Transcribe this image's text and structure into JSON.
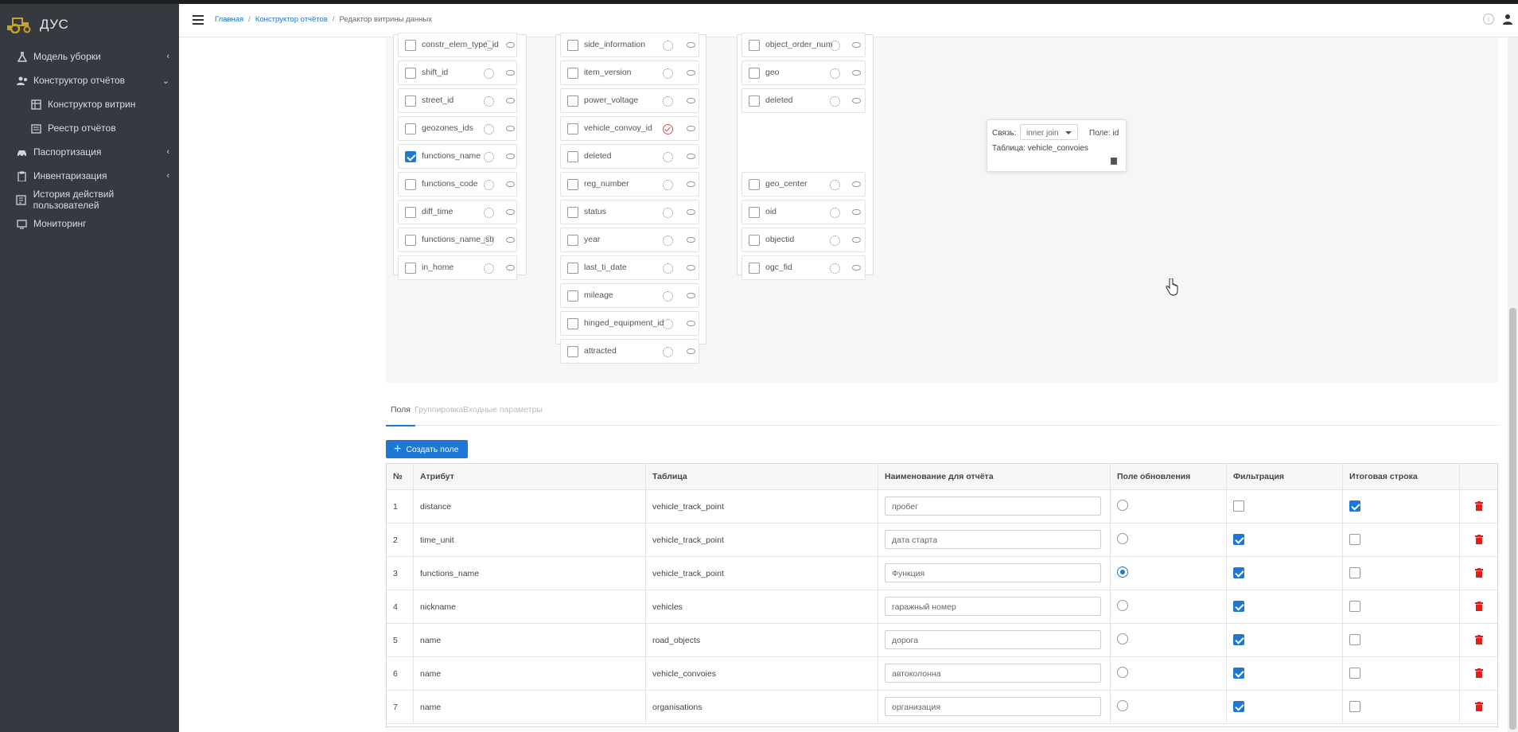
{
  "app": {
    "title": "ДУС"
  },
  "sidebar": {
    "items": [
      {
        "label": "Модель уборки",
        "icon": "flask-icon",
        "chevron": "‹"
      },
      {
        "label": "Конструктор отчётов",
        "icon": "users-icon",
        "chevron": "⌄"
      },
      {
        "label": "Конструктор витрин",
        "icon": "table-icon",
        "sub": true
      },
      {
        "label": "Реестр отчётов",
        "icon": "list-icon",
        "sub": true
      },
      {
        "label": "Паспортизация",
        "icon": "car-icon",
        "chevron": "‹"
      },
      {
        "label": "Инвентаризация",
        "icon": "clipboard-icon",
        "chevron": "‹"
      },
      {
        "label": "История действий пользователей",
        "icon": "history-icon"
      },
      {
        "label": "Мониторинг",
        "icon": "monitor-icon"
      }
    ]
  },
  "breadcrumb": {
    "home": "Главная",
    "section": "Конструктор отчётов",
    "current": "Редактор витрины данных",
    "sep": "/"
  },
  "tables": [
    {
      "fields": [
        "constr_elem_type_id",
        "shift_id",
        "street_id",
        "geozones_ids",
        "functions_name",
        "functions_code",
        "diff_time",
        "functions_name_str",
        "in_home"
      ],
      "checked": [
        false,
        false,
        false,
        false,
        true,
        false,
        false,
        false,
        false
      ],
      "linked": [
        false,
        false,
        false,
        false,
        false,
        false,
        false,
        false,
        false
      ]
    },
    {
      "fields": [
        "side_information",
        "item_version",
        "power_voltage",
        "vehicle_convoy_id",
        "deleted",
        "reg_number",
        "status",
        "year",
        "last_ti_date",
        "mileage",
        "hinged_equipment_id",
        "attracted"
      ],
      "checked": [
        false,
        false,
        false,
        false,
        false,
        false,
        false,
        false,
        false,
        false,
        false,
        false
      ],
      "linked": [
        false,
        false,
        false,
        true,
        false,
        false,
        false,
        false,
        false,
        false,
        false,
        false
      ]
    },
    {
      "fields": [
        "object_order_num",
        "geo",
        "deleted",
        "",
        "",
        "geo_center",
        "oid",
        "objectid",
        "ogc_fid"
      ],
      "checked": [
        false,
        false,
        false,
        false,
        false,
        false,
        false,
        false,
        false
      ],
      "linked": [
        false,
        false,
        false,
        false,
        false,
        false,
        false,
        false,
        false
      ]
    }
  ],
  "link_popup": {
    "relation_label": "Связь:",
    "join_type": "inner join",
    "field_label": "Поле: id",
    "table_label": "Таблица: vehicle_convoies"
  },
  "tabs": [
    "Поля",
    "Группировка",
    "Входные параметры"
  ],
  "create_field_label": "Создать поле",
  "grid": {
    "columns": [
      "№",
      "Атрибут",
      "Таблица",
      "Наименование для отчёта",
      "Поле обновления",
      "Фильтрация",
      "Итоговая строка"
    ],
    "rows": [
      {
        "num": "1",
        "attr": "distance",
        "table": "vehicle_track_point",
        "name": "пробег",
        "update": false,
        "filter": false,
        "total": true
      },
      {
        "num": "2",
        "attr": "time_unit",
        "table": "vehicle_track_point",
        "name": "дата старта",
        "update": false,
        "filter": true,
        "total": false
      },
      {
        "num": "3",
        "attr": "functions_name",
        "table": "vehicle_track_point",
        "name": "Функция",
        "update": true,
        "filter": true,
        "total": false
      },
      {
        "num": "4",
        "attr": "nickname",
        "table": "vehicles",
        "name": "гаражный номер",
        "update": false,
        "filter": true,
        "total": false
      },
      {
        "num": "5",
        "attr": "name",
        "table": "road_objects",
        "name": "дорога",
        "update": false,
        "filter": true,
        "total": false
      },
      {
        "num": "6",
        "attr": "name",
        "table": "vehicle_convoies",
        "name": "автоколонна",
        "update": false,
        "filter": true,
        "total": false
      },
      {
        "num": "7",
        "attr": "name",
        "table": "organisations",
        "name": "организация",
        "update": false,
        "filter": true,
        "total": false
      }
    ]
  },
  "colors": {
    "accent": "#1e77d4",
    "sidebar": "#343a40",
    "danger": "#e0201b"
  }
}
